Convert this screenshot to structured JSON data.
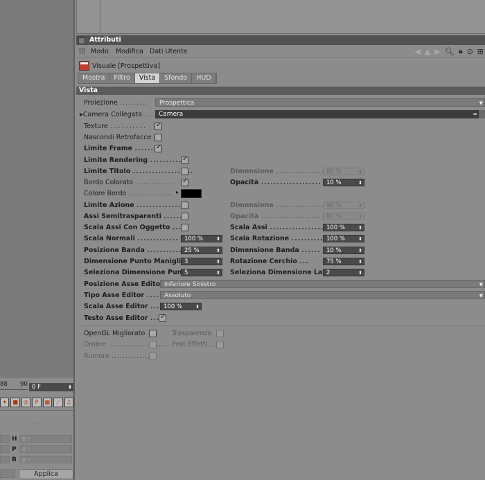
{
  "panel": {
    "title": "Attributi",
    "menu": [
      "Modo",
      "Modifica",
      "Dati Utente"
    ],
    "object_title": "Visuale [Prospettiva]",
    "tabs": [
      {
        "label": "Mostra",
        "active": false
      },
      {
        "label": "Filtro",
        "active": false
      },
      {
        "label": "Vista",
        "active": true
      },
      {
        "label": "Sfondo",
        "active": false
      },
      {
        "label": "HUD",
        "active": false
      }
    ],
    "section": "Vista"
  },
  "fields": {
    "proiezione": {
      "label": "Proiezione",
      "value": "Prospettica"
    },
    "camera": {
      "label": "Camera Collegata",
      "value": "Camera"
    },
    "texture": {
      "label": "Texture",
      "checked": true
    },
    "nascondi": {
      "label": "Nascondi Retrofacce",
      "checked": false
    },
    "limite_frame": {
      "label": "Limite Frame",
      "checked": true
    },
    "limite_rendering": {
      "label": "Limite Rendering",
      "checked": true
    },
    "limite_titolo": {
      "label": "Limite Titolo",
      "checked": false
    },
    "dimensione1": {
      "label": "Dimensione",
      "value": "80 %"
    },
    "bordo_colorato": {
      "label": "Bordo Colorato",
      "checked": true
    },
    "opacita1": {
      "label": "Opacità",
      "value": "10 %"
    },
    "colore_bordo": {
      "label": "Colore Bordo",
      "color": "#000000"
    },
    "limite_azione": {
      "label": "Limite Azione",
      "checked": false
    },
    "dimensione2": {
      "label": "Dimensione",
      "value": "90 %"
    },
    "assi_semi": {
      "label": "Assi Semitrasparenti",
      "checked": false
    },
    "opacita2": {
      "label": "Opacità",
      "value": "80 %"
    },
    "scala_assi_oggetto": {
      "label": "Scala Assi Con Oggetto",
      "checked": false
    },
    "scala_assi": {
      "label": "Scala Assi",
      "value": "100 %"
    },
    "scala_normali": {
      "label": "Scala Normali",
      "value": "100 %"
    },
    "scala_rotazione": {
      "label": "Scala Rotazione",
      "value": "100 %"
    },
    "posizione_banda": {
      "label": "Posizione Banda",
      "value": "25 %"
    },
    "dimensione_banda": {
      "label": "Dimensione Banda",
      "value": "10 %"
    },
    "dim_punto_maniglia": {
      "label": "Dimensione Punto Maniglia",
      "value": "3"
    },
    "rotazione_cerchio": {
      "label": "Rotazione Cerchio",
      "value": "75 %"
    },
    "sel_dim_punto": {
      "label": "Seleziona Dimensione Punto",
      "value": "5"
    },
    "sel_dim_lato": {
      "label": "Seleziona Dimensione Lato",
      "value": "2"
    },
    "pos_asse_editor": {
      "label": "Posizione Asse Editor",
      "value": "Inferiore Sinistro"
    },
    "tipo_asse_editor": {
      "label": "Tipo Asse Editor",
      "value": "Assoluto"
    },
    "scala_asse_editor": {
      "label": "Scala Asse Editor",
      "value": "100 %"
    },
    "testo_asse_editor": {
      "label": "Testo Asse Editor",
      "checked": true
    },
    "opengl": {
      "label": "OpenGL Migliorato",
      "checked": false
    },
    "trasparenza": {
      "label": "Trasparenza",
      "checked": false
    },
    "ombre": {
      "label": "Ombre",
      "checked": false
    },
    "post_effetti": {
      "label": "Post Effetti",
      "checked": false
    },
    "rumore": {
      "label": "Rumore",
      "checked": false
    }
  },
  "left": {
    "timeline_nums": [
      "88",
      "90"
    ],
    "frame": "0 F",
    "coord_header": "---",
    "coords": [
      {
        "axis": "H",
        "value": "0 °"
      },
      {
        "axis": "P",
        "value": "0 °"
      },
      {
        "axis": "B",
        "value": "0 °"
      }
    ],
    "apply": "Applica"
  },
  "dots": {
    "proiezione": "..........",
    "camera": "....",
    "texture": ".............",
    "nascondi": ".",
    "limite_frame": ".......",
    "limite_rendering": "..........",
    "limite_titolo": "...................",
    "dimensione": "................",
    "bordo_colorato": "..............",
    "opacita": "...................",
    "colore_bordo": "................",
    "limite_azione": "...............",
    "assi_semi": "........",
    "scala_assi_oggetto": "...",
    "scala_assi": "..................",
    "scala_normali": ".............",
    "scala_rotazione": "...........",
    "posizione_banda": "............",
    "dimensione_banda": "......",
    "dim_punto_maniglia": "..",
    "rotazione_cerchio": "...",
    "sel_dim_punto": ".",
    "pos_asse_editor": "",
    "tipo_asse_editor": ".....",
    "scala_asse_editor": "....",
    "testo_asse_editor": "....",
    "opengl": "...",
    "trasparenza": "",
    "ombre": "......................",
    "post_effetti": "...",
    "rumore": "................"
  }
}
